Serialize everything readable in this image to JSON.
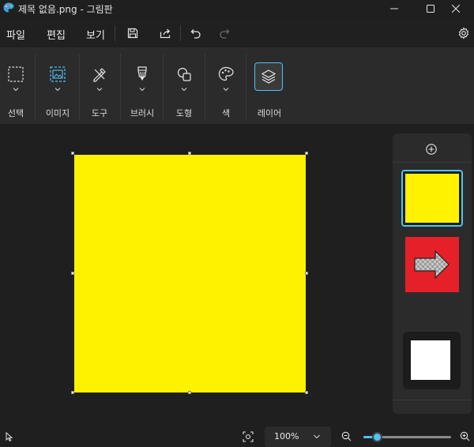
{
  "window": {
    "title": "제목 없음.png - 그림판",
    "app_icon": "paint-palette-icon",
    "controls": [
      "minimize-icon",
      "maximize-icon",
      "close-icon"
    ]
  },
  "menu": {
    "items": [
      {
        "label": "파일"
      },
      {
        "label": "편집"
      },
      {
        "label": "보기"
      }
    ],
    "actions": [
      "save-icon",
      "share-icon",
      "undo-icon",
      "redo-icon"
    ],
    "settings_icon": "gear-icon"
  },
  "ribbon": {
    "groups": [
      {
        "label": "선택",
        "icon": "selection-icon"
      },
      {
        "label": "이미지",
        "icon": "image-icon"
      },
      {
        "label": "도구",
        "icon": "tools-icon"
      },
      {
        "label": "브러시",
        "icon": "brush-icon"
      },
      {
        "label": "도형",
        "icon": "shapes-icon"
      },
      {
        "label": "색",
        "icon": "color-palette-icon"
      },
      {
        "label": "레이어",
        "icon": "layers-icon",
        "active": true
      }
    ]
  },
  "canvas": {
    "fill_color": "#fff200"
  },
  "layers_panel": {
    "add_icon": "add-layer-icon",
    "layers": [
      {
        "name": "layer-yellow",
        "color": "#fff200",
        "selected": true
      },
      {
        "name": "layer-red-arrow",
        "color": "#e62029",
        "selected": false
      },
      {
        "name": "layer-white",
        "color": "#ffffff",
        "selected": false
      }
    ]
  },
  "statusbar": {
    "pointer_icon": "cursor-icon",
    "fit_icon": "fit-to-window-icon",
    "zoom_value": "100%",
    "zoom_out_icon": "zoom-out-icon",
    "zoom_in_icon": "zoom-in-icon",
    "zoom_slider_fraction": 0.15
  },
  "colors": {
    "accent": "#4fc3f7",
    "background": "#1f1f1f",
    "ribbon": "#2b2b2b"
  }
}
